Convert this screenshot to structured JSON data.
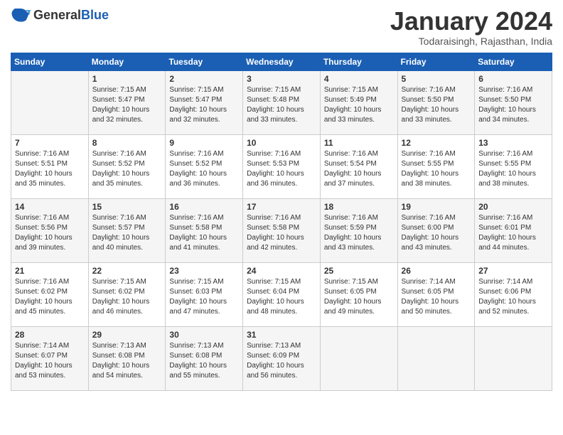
{
  "logo": {
    "general": "General",
    "blue": "Blue"
  },
  "title": "January 2024",
  "location": "Todaraisingh, Rajasthan, India",
  "days_of_week": [
    "Sunday",
    "Monday",
    "Tuesday",
    "Wednesday",
    "Thursday",
    "Friday",
    "Saturday"
  ],
  "weeks": [
    [
      {
        "day": "",
        "sunrise": "",
        "sunset": "",
        "daylight": ""
      },
      {
        "day": "1",
        "sunrise": "Sunrise: 7:15 AM",
        "sunset": "Sunset: 5:47 PM",
        "daylight": "Daylight: 10 hours and 32 minutes."
      },
      {
        "day": "2",
        "sunrise": "Sunrise: 7:15 AM",
        "sunset": "Sunset: 5:47 PM",
        "daylight": "Daylight: 10 hours and 32 minutes."
      },
      {
        "day": "3",
        "sunrise": "Sunrise: 7:15 AM",
        "sunset": "Sunset: 5:48 PM",
        "daylight": "Daylight: 10 hours and 33 minutes."
      },
      {
        "day": "4",
        "sunrise": "Sunrise: 7:15 AM",
        "sunset": "Sunset: 5:49 PM",
        "daylight": "Daylight: 10 hours and 33 minutes."
      },
      {
        "day": "5",
        "sunrise": "Sunrise: 7:16 AM",
        "sunset": "Sunset: 5:50 PM",
        "daylight": "Daylight: 10 hours and 33 minutes."
      },
      {
        "day": "6",
        "sunrise": "Sunrise: 7:16 AM",
        "sunset": "Sunset: 5:50 PM",
        "daylight": "Daylight: 10 hours and 34 minutes."
      }
    ],
    [
      {
        "day": "7",
        "sunrise": "Sunrise: 7:16 AM",
        "sunset": "Sunset: 5:51 PM",
        "daylight": "Daylight: 10 hours and 35 minutes."
      },
      {
        "day": "8",
        "sunrise": "Sunrise: 7:16 AM",
        "sunset": "Sunset: 5:52 PM",
        "daylight": "Daylight: 10 hours and 35 minutes."
      },
      {
        "day": "9",
        "sunrise": "Sunrise: 7:16 AM",
        "sunset": "Sunset: 5:52 PM",
        "daylight": "Daylight: 10 hours and 36 minutes."
      },
      {
        "day": "10",
        "sunrise": "Sunrise: 7:16 AM",
        "sunset": "Sunset: 5:53 PM",
        "daylight": "Daylight: 10 hours and 36 minutes."
      },
      {
        "day": "11",
        "sunrise": "Sunrise: 7:16 AM",
        "sunset": "Sunset: 5:54 PM",
        "daylight": "Daylight: 10 hours and 37 minutes."
      },
      {
        "day": "12",
        "sunrise": "Sunrise: 7:16 AM",
        "sunset": "Sunset: 5:55 PM",
        "daylight": "Daylight: 10 hours and 38 minutes."
      },
      {
        "day": "13",
        "sunrise": "Sunrise: 7:16 AM",
        "sunset": "Sunset: 5:55 PM",
        "daylight": "Daylight: 10 hours and 38 minutes."
      }
    ],
    [
      {
        "day": "14",
        "sunrise": "Sunrise: 7:16 AM",
        "sunset": "Sunset: 5:56 PM",
        "daylight": "Daylight: 10 hours and 39 minutes."
      },
      {
        "day": "15",
        "sunrise": "Sunrise: 7:16 AM",
        "sunset": "Sunset: 5:57 PM",
        "daylight": "Daylight: 10 hours and 40 minutes."
      },
      {
        "day": "16",
        "sunrise": "Sunrise: 7:16 AM",
        "sunset": "Sunset: 5:58 PM",
        "daylight": "Daylight: 10 hours and 41 minutes."
      },
      {
        "day": "17",
        "sunrise": "Sunrise: 7:16 AM",
        "sunset": "Sunset: 5:58 PM",
        "daylight": "Daylight: 10 hours and 42 minutes."
      },
      {
        "day": "18",
        "sunrise": "Sunrise: 7:16 AM",
        "sunset": "Sunset: 5:59 PM",
        "daylight": "Daylight: 10 hours and 43 minutes."
      },
      {
        "day": "19",
        "sunrise": "Sunrise: 7:16 AM",
        "sunset": "Sunset: 6:00 PM",
        "daylight": "Daylight: 10 hours and 43 minutes."
      },
      {
        "day": "20",
        "sunrise": "Sunrise: 7:16 AM",
        "sunset": "Sunset: 6:01 PM",
        "daylight": "Daylight: 10 hours and 44 minutes."
      }
    ],
    [
      {
        "day": "21",
        "sunrise": "Sunrise: 7:16 AM",
        "sunset": "Sunset: 6:02 PM",
        "daylight": "Daylight: 10 hours and 45 minutes."
      },
      {
        "day": "22",
        "sunrise": "Sunrise: 7:15 AM",
        "sunset": "Sunset: 6:02 PM",
        "daylight": "Daylight: 10 hours and 46 minutes."
      },
      {
        "day": "23",
        "sunrise": "Sunrise: 7:15 AM",
        "sunset": "Sunset: 6:03 PM",
        "daylight": "Daylight: 10 hours and 47 minutes."
      },
      {
        "day": "24",
        "sunrise": "Sunrise: 7:15 AM",
        "sunset": "Sunset: 6:04 PM",
        "daylight": "Daylight: 10 hours and 48 minutes."
      },
      {
        "day": "25",
        "sunrise": "Sunrise: 7:15 AM",
        "sunset": "Sunset: 6:05 PM",
        "daylight": "Daylight: 10 hours and 49 minutes."
      },
      {
        "day": "26",
        "sunrise": "Sunrise: 7:14 AM",
        "sunset": "Sunset: 6:05 PM",
        "daylight": "Daylight: 10 hours and 50 minutes."
      },
      {
        "day": "27",
        "sunrise": "Sunrise: 7:14 AM",
        "sunset": "Sunset: 6:06 PM",
        "daylight": "Daylight: 10 hours and 52 minutes."
      }
    ],
    [
      {
        "day": "28",
        "sunrise": "Sunrise: 7:14 AM",
        "sunset": "Sunset: 6:07 PM",
        "daylight": "Daylight: 10 hours and 53 minutes."
      },
      {
        "day": "29",
        "sunrise": "Sunrise: 7:13 AM",
        "sunset": "Sunset: 6:08 PM",
        "daylight": "Daylight: 10 hours and 54 minutes."
      },
      {
        "day": "30",
        "sunrise": "Sunrise: 7:13 AM",
        "sunset": "Sunset: 6:08 PM",
        "daylight": "Daylight: 10 hours and 55 minutes."
      },
      {
        "day": "31",
        "sunrise": "Sunrise: 7:13 AM",
        "sunset": "Sunset: 6:09 PM",
        "daylight": "Daylight: 10 hours and 56 minutes."
      },
      {
        "day": "",
        "sunrise": "",
        "sunset": "",
        "daylight": ""
      },
      {
        "day": "",
        "sunrise": "",
        "sunset": "",
        "daylight": ""
      },
      {
        "day": "",
        "sunrise": "",
        "sunset": "",
        "daylight": ""
      }
    ]
  ]
}
